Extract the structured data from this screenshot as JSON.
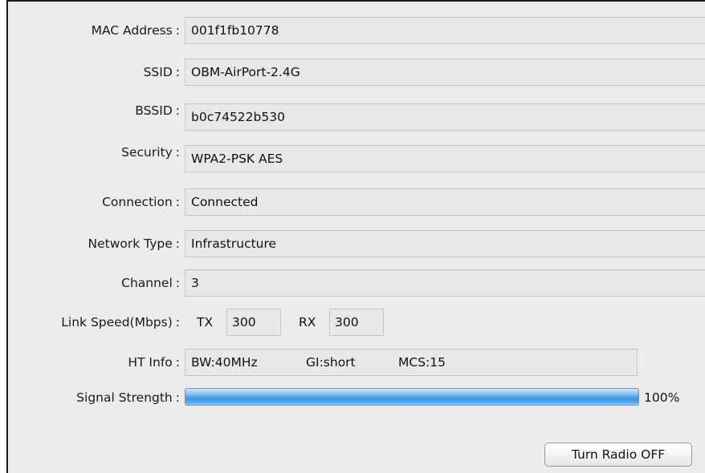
{
  "fields": {
    "mac": {
      "label": "MAC Address",
      "value": "001f1fb10778"
    },
    "ssid": {
      "label": "SSID",
      "value": "OBM-AirPort-2.4G"
    },
    "bssid": {
      "label": "BSSID",
      "value": "b0c74522b530"
    },
    "security": {
      "label": "Security",
      "value": "WPA2-PSK AES"
    },
    "connection": {
      "label": "Connection",
      "value": "Connected"
    },
    "network_type": {
      "label": "Network Type",
      "value": "Infrastructure"
    },
    "channel": {
      "label": "Channel",
      "value": "3"
    }
  },
  "link_speed": {
    "label": "Link Speed(Mbps)",
    "tx_label": "TX",
    "tx_value": "300",
    "rx_label": "RX",
    "rx_value": "300"
  },
  "ht_info": {
    "label": "HT Info",
    "bw": "BW:40MHz",
    "gi": "GI:short",
    "mcs": "MCS:15"
  },
  "signal": {
    "label": "Signal Strength",
    "percent_text": "100%",
    "level": 100,
    "bar_color": "#3d97e8"
  },
  "colon": ":",
  "radio_button": {
    "label": "Turn Radio OFF"
  }
}
